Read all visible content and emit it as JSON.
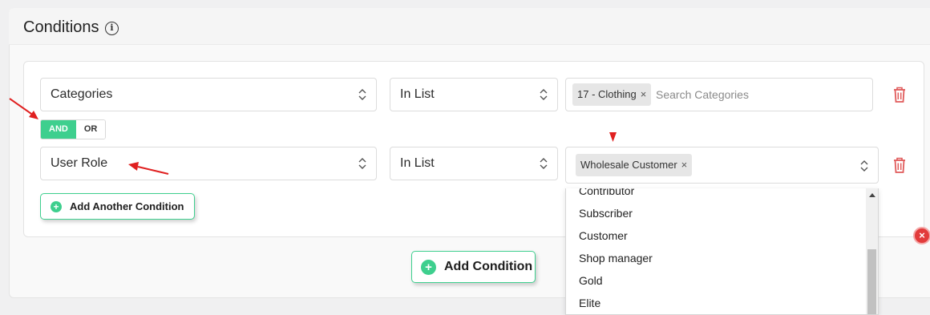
{
  "panel": {
    "title": "Conditions",
    "info_icon": "info-circle-icon"
  },
  "logic": {
    "and_label": "AND",
    "or_label": "OR",
    "selected": "AND"
  },
  "rows": [
    {
      "field": "Categories",
      "operator": "In List",
      "tags": [
        {
          "label": "17 - Clothing",
          "remove": "×"
        }
      ],
      "search_placeholder": "Search Categories"
    },
    {
      "field": "User Role",
      "operator": "In List",
      "tags": [
        {
          "label": "Wholesale Customer",
          "remove": "×"
        }
      ]
    }
  ],
  "dropdown": {
    "options": [
      "Contributor",
      "Subscriber",
      "Customer",
      "Shop manager",
      "Gold",
      "Elite"
    ]
  },
  "buttons": {
    "add_another": "Add Another Condition",
    "add_condition": "Add Condition",
    "plus": "+",
    "close": "×"
  },
  "colors": {
    "accent_green": "#3ecf8e",
    "delete_red": "#e05a5a",
    "annotation_red": "#e02020"
  }
}
